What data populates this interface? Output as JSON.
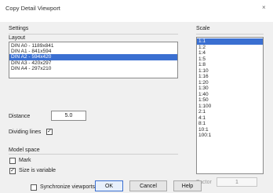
{
  "window": {
    "title": "Copy Detail Viewport",
    "close_glyph": "×"
  },
  "settings": {
    "group_label": "Settings",
    "layout_label": "Layout",
    "layouts": [
      "DIN A0 - 1189x841",
      "DIN A1 - 841x594",
      "DIN A2 - 594x420",
      "DIN A3 - 420x297",
      "DIN A4 - 297x210"
    ],
    "selected_layout": "DIN A2 - 594x420",
    "distance_label": "Distance",
    "distance_value": "5.0",
    "dividing_lines_label": "Dividing lines",
    "dividing_lines_checked": true
  },
  "model_space": {
    "group_label": "Model space",
    "mark_label": "Mark",
    "mark_checked": false,
    "size_variable_label": "Size is variable",
    "size_variable_checked": true,
    "sync_label": "Synchronize viewports",
    "sync_checked": false
  },
  "scale": {
    "group_label": "Scale",
    "items": [
      "1:1",
      "1:2",
      "1:4",
      "1:5",
      "1:8",
      "1:10",
      "1:16",
      "1:20",
      "1:30",
      "1:40",
      "1:50",
      "1:100",
      "2:1",
      "4:1",
      "8:1",
      "10:1",
      "100:1"
    ],
    "selected": "1:1",
    "factor_label": "Factor",
    "factor_value": "1"
  },
  "buttons": {
    "ok": "OK",
    "cancel": "Cancel",
    "help": "Help"
  },
  "colors": {
    "selection": "#3a6fd1",
    "dialog_bg": "#f0f0f0"
  }
}
